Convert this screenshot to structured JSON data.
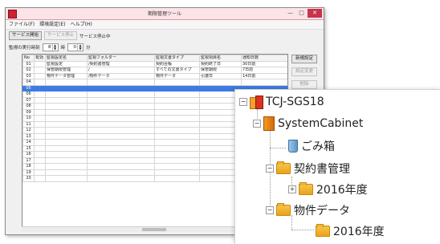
{
  "window": {
    "title": "期限管理ツール",
    "controls": {
      "minimize": "—",
      "maximize": "□",
      "close": "✕"
    }
  },
  "menu": [
    "ファイル(F)",
    "環境設定(E)",
    "ヘルプ(H)"
  ],
  "toolbar": {
    "start_label": "サービス開始",
    "stop_label": "サービス停止",
    "status": "サービス停止中"
  },
  "interval": {
    "label": "監視の実行時刻",
    "hour_value": "8",
    "hour_unit": "時",
    "minute_value": "0",
    "minute_unit": "分"
  },
  "table": {
    "headers": [
      "No",
      "有効",
      "監視設定名",
      "監視フォルダー",
      "監視文書タイプ",
      "監視項目名",
      "通知日数"
    ],
    "rows": [
      [
        "01",
        "",
        "監視設定",
        "/契約書管理",
        "契約台帳",
        "契約終了日",
        "30日前"
      ],
      [
        "02",
        "",
        "保管期限管理",
        "/",
        "すべての文書タイプ",
        "保管期限",
        "7日前"
      ],
      [
        "03",
        "",
        "物件データ管理",
        "/物件データ",
        "物件データ",
        "引渡日",
        "14日前"
      ],
      [
        "04",
        "",
        "",
        "",
        "",
        "",
        ""
      ],
      [
        "05",
        "",
        "",
        "",
        "",
        "",
        ""
      ],
      [
        "06",
        "",
        "",
        "",
        "",
        "",
        ""
      ],
      [
        "07",
        "",
        "",
        "",
        "",
        "",
        ""
      ],
      [
        "08",
        "",
        "",
        "",
        "",
        "",
        ""
      ],
      [
        "09",
        "",
        "",
        "",
        "",
        "",
        ""
      ],
      [
        "10",
        "",
        "",
        "",
        "",
        "",
        ""
      ],
      [
        "11",
        "",
        "",
        "",
        "",
        "",
        ""
      ],
      [
        "12",
        "",
        "",
        "",
        "",
        "",
        ""
      ],
      [
        "13",
        "",
        "",
        "",
        "",
        "",
        ""
      ],
      [
        "14",
        "",
        "",
        "",
        "",
        "",
        ""
      ],
      [
        "15",
        "",
        "",
        "",
        "",
        "",
        ""
      ],
      [
        "16",
        "",
        "",
        "",
        "",
        "",
        ""
      ],
      [
        "17",
        "",
        "",
        "",
        "",
        "",
        ""
      ],
      [
        "18",
        "",
        "",
        "",
        "",
        "",
        ""
      ],
      [
        "19",
        "",
        "",
        "",
        "",
        "",
        ""
      ],
      [
        "20",
        "",
        "",
        "",
        "",
        "",
        ""
      ]
    ],
    "selected_row": "05"
  },
  "side_buttons": [
    "新規設定",
    "設定変更",
    "削除"
  ],
  "tree": {
    "root": "TCJ-SGS18",
    "cabinet": "SystemCabinet",
    "trash": "ごみ箱",
    "folder1": "契約書管理",
    "folder1_child": "2016年度",
    "folder2": "物件データ",
    "folder2_child": "2016年度",
    "collapse_symbol": "−",
    "expand_symbol": "+"
  }
}
